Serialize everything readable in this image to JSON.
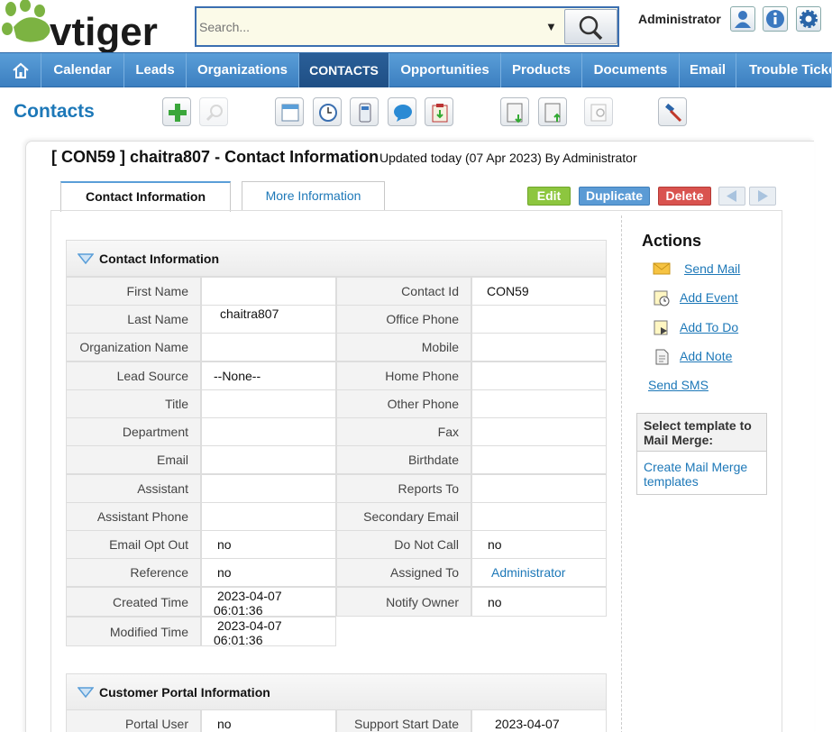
{
  "app": {
    "logo_text": "vtiger"
  },
  "search": {
    "placeholder": "Search..."
  },
  "user": {
    "name": "Administrator"
  },
  "nav": {
    "home_icon": "home-icon",
    "items": [
      "Calendar",
      "Leads",
      "Organizations",
      "CONTACTS",
      "Opportunities",
      "Products",
      "Documents",
      "Email",
      "Trouble Tickets"
    ],
    "active": "CONTACTS"
  },
  "module": {
    "title": "Contacts"
  },
  "record": {
    "title": "[ CON59 ] chaitra807 - Contact Information",
    "updated": "Updated today (07 Apr 2023) By Administrator"
  },
  "tabs": [
    "Contact Information",
    "More Information"
  ],
  "buttons": {
    "edit": "Edit",
    "duplicate": "Duplicate",
    "delete": "Delete"
  },
  "colors": {
    "edit": "#8dc63f",
    "duplicate": "#5b9bd5",
    "delete": "#d9534f",
    "link": "#1d78b8",
    "nav": "#4a90d0"
  },
  "contact_block": {
    "title": "Contact Information",
    "rows": [
      {
        "l1": "First Name",
        "v1": "",
        "l2": "Contact Id",
        "v2": "CON59"
      },
      {
        "l1": "Last Name",
        "v1": "chaitra807",
        "l2": "Office Phone",
        "v2": ""
      },
      {
        "l1": "Organization Name",
        "v1": "",
        "l2": "Mobile",
        "v2": ""
      },
      {
        "l1": "Lead Source",
        "v1": "--None--",
        "l2": "Home Phone",
        "v2": ""
      },
      {
        "l1": "Title",
        "v1": "",
        "l2": "Other Phone",
        "v2": ""
      },
      {
        "l1": "Department",
        "v1": "",
        "l2": "Fax",
        "v2": ""
      },
      {
        "l1": "Email",
        "v1": "",
        "l2": "Birthdate",
        "v2": ""
      },
      {
        "l1": "Assistant",
        "v1": "",
        "l2": "Reports To",
        "v2": ""
      },
      {
        "l1": "Assistant Phone",
        "v1": "",
        "l2": "Secondary Email",
        "v2": ""
      },
      {
        "l1": "Email Opt Out",
        "v1": "no",
        "l2": "Do Not Call",
        "v2": "no"
      },
      {
        "l1": "Reference",
        "v1": "no",
        "l2": "Assigned To",
        "v2": "Administrator"
      },
      {
        "l1": "Created Time",
        "v1a": "2023-04-07",
        "v1b": "06:01:36",
        "l2": "Notify Owner",
        "v2": "no"
      },
      {
        "l1": "Modified Time",
        "v1a": "2023-04-07",
        "v1b": "06:01:36"
      }
    ]
  },
  "portal_block": {
    "title": "Customer Portal Information",
    "rows": [
      {
        "l1": "Portal User",
        "v1": "no",
        "l2": "Support Start Date",
        "v2": "2023-04-07"
      }
    ]
  },
  "actions": {
    "title": "Actions",
    "items": [
      "Send Mail",
      "Add Event",
      "Add To Do",
      "Add Note"
    ],
    "send_sms": "Send SMS"
  },
  "mail_merge": {
    "title": "Select template to Mail Merge:",
    "link": "Create Mail Merge templates"
  }
}
